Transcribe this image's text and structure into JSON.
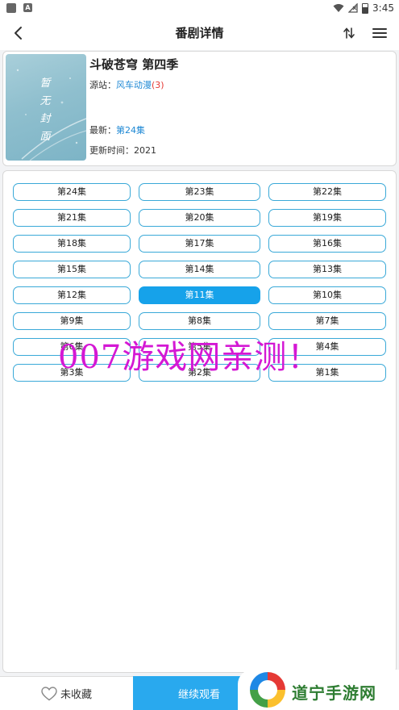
{
  "status_bar": {
    "time": "3:45"
  },
  "header": {
    "title": "番剧详情"
  },
  "show": {
    "title": "斗破苍穹 第四季",
    "cover_text": "暂无封面",
    "source_label": "源站：",
    "source_name": "风车动漫",
    "source_count": "(3)",
    "latest_label": "最新：",
    "latest_value": "第24集",
    "updated_label": "更新时间：",
    "updated_value": "2021"
  },
  "episodes": [
    {
      "label": "第24集",
      "active": false
    },
    {
      "label": "第23集",
      "active": false
    },
    {
      "label": "第22集",
      "active": false
    },
    {
      "label": "第21集",
      "active": false
    },
    {
      "label": "第20集",
      "active": false
    },
    {
      "label": "第19集",
      "active": false
    },
    {
      "label": "第18集",
      "active": false
    },
    {
      "label": "第17集",
      "active": false
    },
    {
      "label": "第16集",
      "active": false
    },
    {
      "label": "第15集",
      "active": false
    },
    {
      "label": "第14集",
      "active": false
    },
    {
      "label": "第13集",
      "active": false
    },
    {
      "label": "第12集",
      "active": false
    },
    {
      "label": "第11集",
      "active": true
    },
    {
      "label": "第10集",
      "active": false
    },
    {
      "label": "第9集",
      "active": false
    },
    {
      "label": "第8集",
      "active": false
    },
    {
      "label": "第7集",
      "active": false
    },
    {
      "label": "第6集",
      "active": false
    },
    {
      "label": "第5集",
      "active": false
    },
    {
      "label": "第4集",
      "active": false
    },
    {
      "label": "第3集",
      "active": false
    },
    {
      "label": "第2集",
      "active": false
    },
    {
      "label": "第1集",
      "active": false
    }
  ],
  "watermark": "007游戏网亲测！",
  "bottom": {
    "favorite_label": "未收藏",
    "continue_label": "继续观看"
  },
  "brand": {
    "name": "道宁手游网"
  },
  "colors": {
    "accent": "#16a2ea",
    "source_count": "#e53935",
    "link": "#1e88d4",
    "watermark": "#d418d4"
  }
}
